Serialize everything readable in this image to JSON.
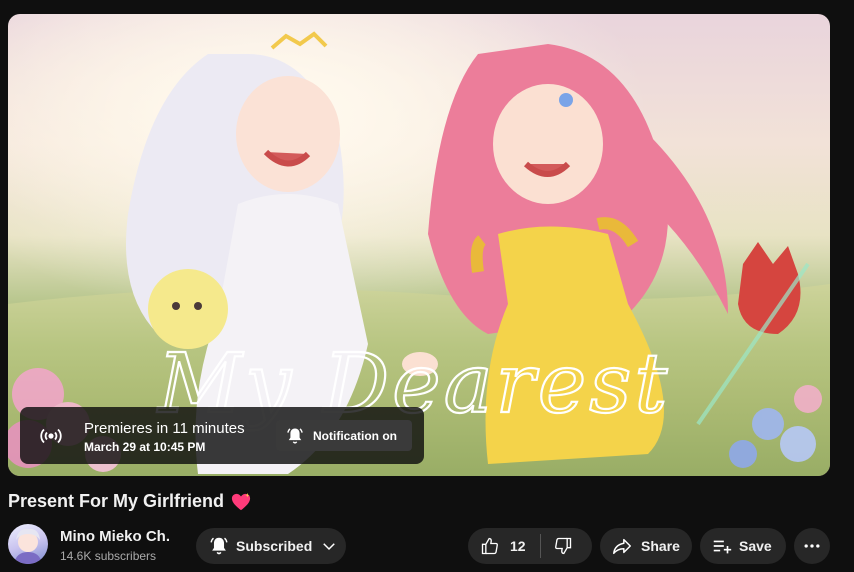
{
  "video": {
    "title": "Present For My Girlfriend",
    "title_emoji": "sparkling-heart-icon",
    "thumbnail_text": "My Dearest"
  },
  "premiere": {
    "title": "Premieres in 11 minutes",
    "date": "March 29 at 10:45 PM",
    "notification_label": "Notification on"
  },
  "channel": {
    "name": "Mino Mieko Ch.",
    "subscribers": "14.6K subscribers",
    "subscribe_state_label": "Subscribed"
  },
  "actions": {
    "like_count": "12",
    "share_label": "Share",
    "save_label": "Save"
  },
  "icons": [
    "live-broadcast-icon",
    "bell-icon",
    "chevron-down-icon",
    "thumbs-up-icon",
    "thumbs-down-icon",
    "share-arrow-icon",
    "playlist-add-icon",
    "more-horizontal-icon"
  ],
  "colors": {
    "background": "#0f0f0f",
    "pill": "#272727",
    "accent_heart": "#ff3b7a"
  }
}
